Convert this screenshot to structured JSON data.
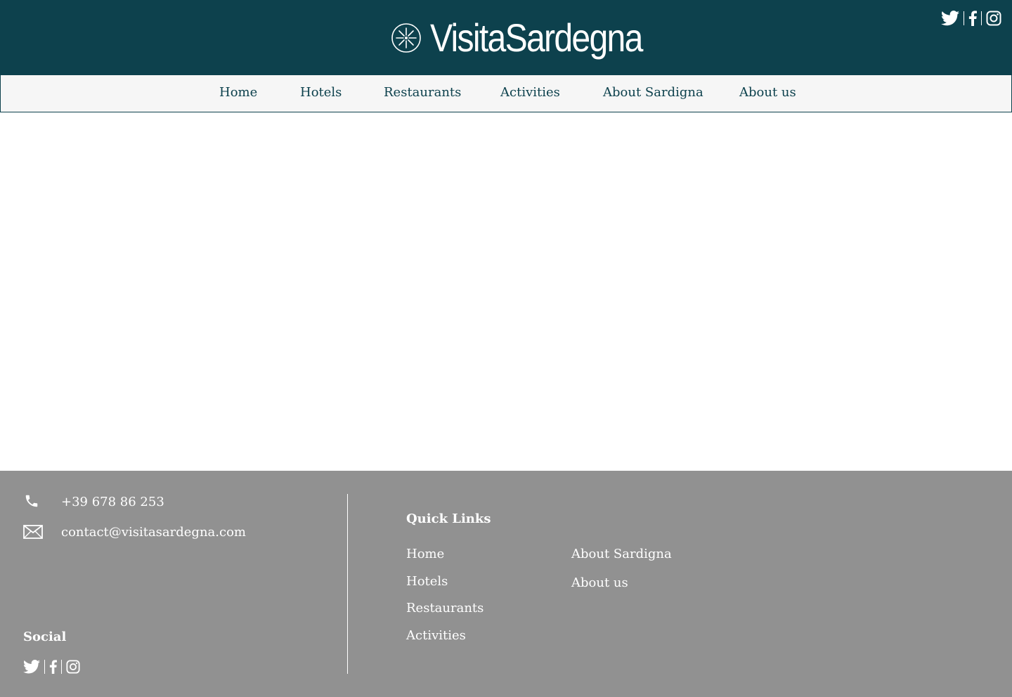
{
  "brand": {
    "name": "VisitaSardegna",
    "logo_icon": "sun-wheel-icon"
  },
  "header": {
    "social_icons": [
      "twitter-icon",
      "facebook-icon",
      "instagram-icon"
    ]
  },
  "nav": {
    "items": [
      "Home",
      "Hotels",
      "Restaurants",
      "Activities",
      "About Sardigna",
      "About us"
    ]
  },
  "footer": {
    "phone": "+39 678 86 253",
    "email": "contact@visitasardegna.com",
    "social_heading": "Social",
    "quick_links_heading": "Quick Links",
    "links_col1": [
      "Home",
      "Hotels",
      "Restaurants",
      "Activities"
    ],
    "links_col2": [
      "About Sardigna",
      "About us"
    ]
  },
  "colors": {
    "header_bg": "#0d414d",
    "nav_bg": "#f6f6f6",
    "footer_bg": "#919191",
    "text_light": "#ffffff"
  }
}
